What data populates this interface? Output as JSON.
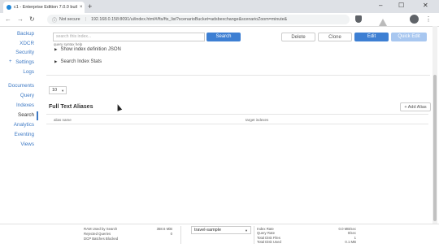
{
  "browser": {
    "tab_title": "c1 - Enterprise Edition 7.0.0 buil",
    "tab_close": "×",
    "new_tab": "+",
    "win_min": "–",
    "win_max": "☐",
    "win_close": "✕",
    "back": "←",
    "forward": "→",
    "reload": "↻",
    "not_secure": "Not secure",
    "url": "192.168.0.158:8091/ui/index.html#/fts/fts_list?scenarioBucket=adsbexchange&scenarioZoom=minute&",
    "kebab": "⋮"
  },
  "nav": {
    "items": [
      "Backup",
      "XDCR",
      "Security",
      "Settings",
      "Logs",
      "Documents",
      "Query",
      "Indexes",
      "Search",
      "Analytics",
      "Eventing",
      "Views"
    ],
    "settings_prefix": "+"
  },
  "main": {
    "search_placeholder": "search this index...",
    "search_button": "Search",
    "delete_button": "Delete",
    "clone_button": "Clone",
    "edit_button": "Edit",
    "quick_edit_button": "Quick Edit",
    "query_syntax_help": "query syntax help",
    "show_index_json": "Show index definition JSON",
    "search_index_stats": "Search Index Stats",
    "page_size": "10",
    "aliases_title": "Full Text Aliases",
    "add_alias_button": "+ Add Alias",
    "col_alias_name": "alias name",
    "col_target_indexes": "target indexes"
  },
  "footer": {
    "left_stats": [
      {
        "label": "RAM Used by Search",
        "value": "358.6 MiB"
      },
      {
        "label": "Rejected Queries",
        "value": "0"
      },
      {
        "label": "DCP Batches Blocked",
        "value": ""
      }
    ],
    "bucket": "travel-sample",
    "right_stats": [
      {
        "label": "Index Rate",
        "value": "0.0 MB/sec"
      },
      {
        "label": "Query Rate",
        "value": "0/sec"
      },
      {
        "label": "Total Disk Files",
        "value": "1"
      },
      {
        "label": "Total Disk Used",
        "value": "0.1 MB"
      }
    ]
  }
}
